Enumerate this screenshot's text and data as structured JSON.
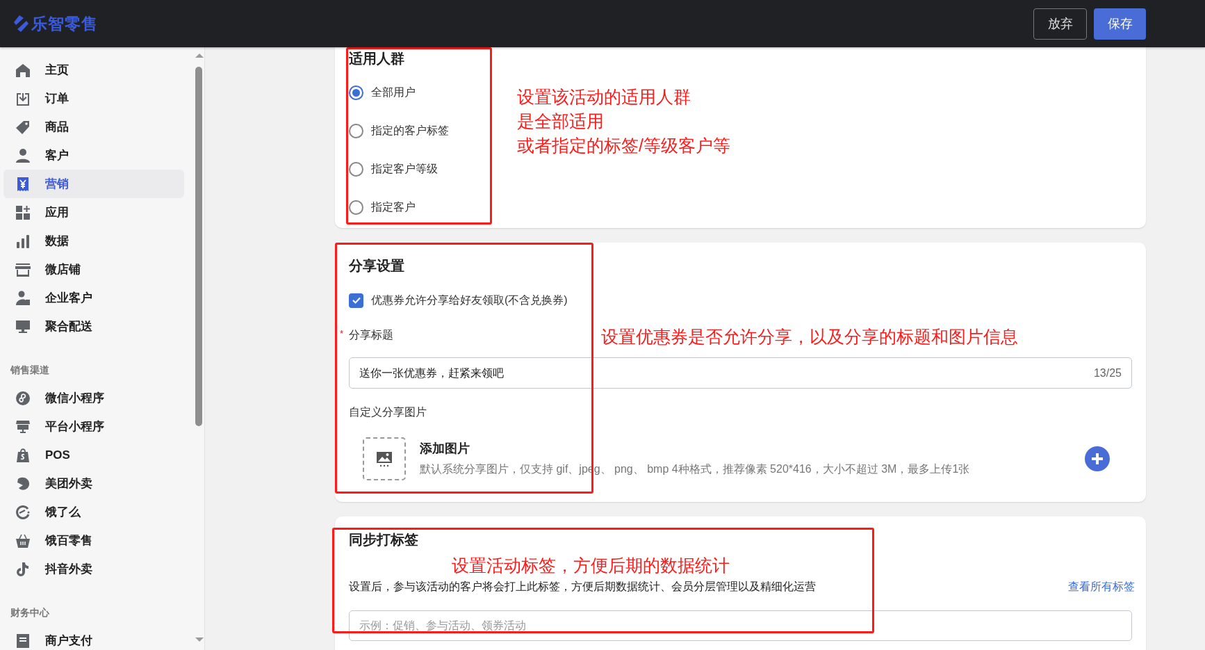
{
  "header": {
    "logo": "乐智零售",
    "buttons": [
      {
        "label": "放弃",
        "kind": "secondary"
      },
      {
        "label": "保存",
        "kind": "primary"
      }
    ]
  },
  "sidebar": {
    "items": [
      {
        "label": "主页",
        "selected": false
      },
      {
        "label": "订单",
        "selected": false
      },
      {
        "label": "商品",
        "selected": false
      },
      {
        "label": "客户",
        "selected": false
      },
      {
        "label": "营销",
        "selected": true
      },
      {
        "label": "应用",
        "selected": false
      },
      {
        "label": "数据",
        "selected": false
      },
      {
        "label": "微店铺",
        "selected": false
      },
      {
        "label": "企业客户",
        "selected": false
      },
      {
        "label": "聚合配送",
        "selected": false
      }
    ],
    "groups": [
      {
        "title": "销售渠道",
        "items": [
          {
            "label": "微信小程序",
            "selected": false
          },
          {
            "label": "平台小程序",
            "selected": false
          },
          {
            "label": "POS",
            "selected": false
          },
          {
            "label": "美团外卖",
            "selected": false
          },
          {
            "label": "饿了么",
            "selected": false
          },
          {
            "label": "饿百零售",
            "selected": false
          },
          {
            "label": "抖音外卖",
            "selected": false
          }
        ]
      },
      {
        "title": "财务中心",
        "items": [
          {
            "label": "商户支付",
            "selected": false
          }
        ]
      }
    ]
  },
  "audience_card": {
    "title": "适用人群",
    "options": [
      {
        "label": "全部用户",
        "selected": true
      },
      {
        "label": "指定的客户标签",
        "selected": false
      },
      {
        "label": "指定客户等级",
        "selected": false
      },
      {
        "label": "指定客户",
        "selected": false
      }
    ],
    "annotation": {
      "lines": [
        "设置该活动的适用人群",
        "是全部适用",
        "或者指定的标签/等级客户等"
      ]
    }
  },
  "share_card": {
    "title": "分享设置",
    "allow_share": {
      "label": "优惠券允许分享给好友领取(不含兑换券)",
      "checked": true
    },
    "share_title": {
      "label": "分享标题",
      "required_mark": "*",
      "value": "送你一张优惠券，赶紧来领吧",
      "counter": "13/25"
    },
    "image": {
      "label": "自定义分享图片",
      "upload_title": "添加图片",
      "upload_hint": "默认系统分享图片，仅支持 gif、jpeg、 png、 bmp 4种格式，推荐像素 520*416，大小不超过 3M，最多上传1张"
    },
    "annotation": {
      "lines": [
        "设置优惠券是否允许分享，以及分享的标题和图片信息"
      ]
    }
  },
  "tag_card": {
    "title": "同步打标签",
    "description": "设置后，参与该活动的客户将会打上此标签，方便后期数据统计、会员分层管理以及精细化运营",
    "link": "查看所有标签",
    "placeholder": "示例：促销、参与活动、领券活动",
    "annotation": {
      "lines": [
        "设置活动标签，方便后期的数据统计"
      ]
    }
  }
}
